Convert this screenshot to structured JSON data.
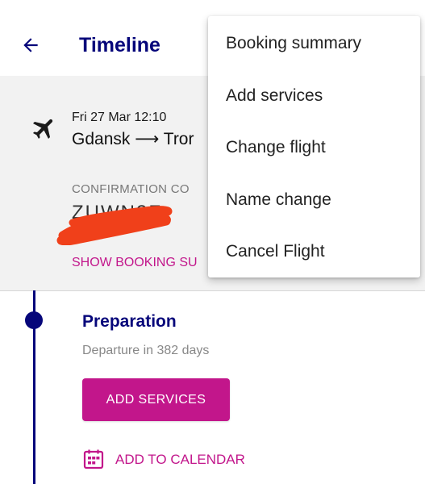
{
  "header": {
    "title": "Timeline",
    "back_icon": "arrow-left-icon"
  },
  "booking": {
    "icon": "airplane-icon",
    "date": "Fri 27 Mar 12:10",
    "route": "Gdansk ⟶ Tror",
    "confirmation_label": "CONFIRMATION CO",
    "confirmation_code": "ZUWN2F",
    "show_summary_label": "SHOW BOOKING SU"
  },
  "timeline": {
    "step_title": "Preparation",
    "step_subtitle": "Departure in 382 days",
    "add_services_label": "ADD SERVICES",
    "calendar_icon": "calendar-icon",
    "add_calendar_label": "ADD TO CALENDAR"
  },
  "menu": {
    "items": [
      {
        "label": "Booking summary"
      },
      {
        "label": "Add services"
      },
      {
        "label": "Change flight"
      },
      {
        "label": "Name change"
      },
      {
        "label": "Cancel Flight"
      }
    ]
  },
  "colors": {
    "brand_navy": "#06067a",
    "brand_magenta": "#c2168b",
    "card_background": "#f2f2f2",
    "redaction": "#f0401a"
  }
}
